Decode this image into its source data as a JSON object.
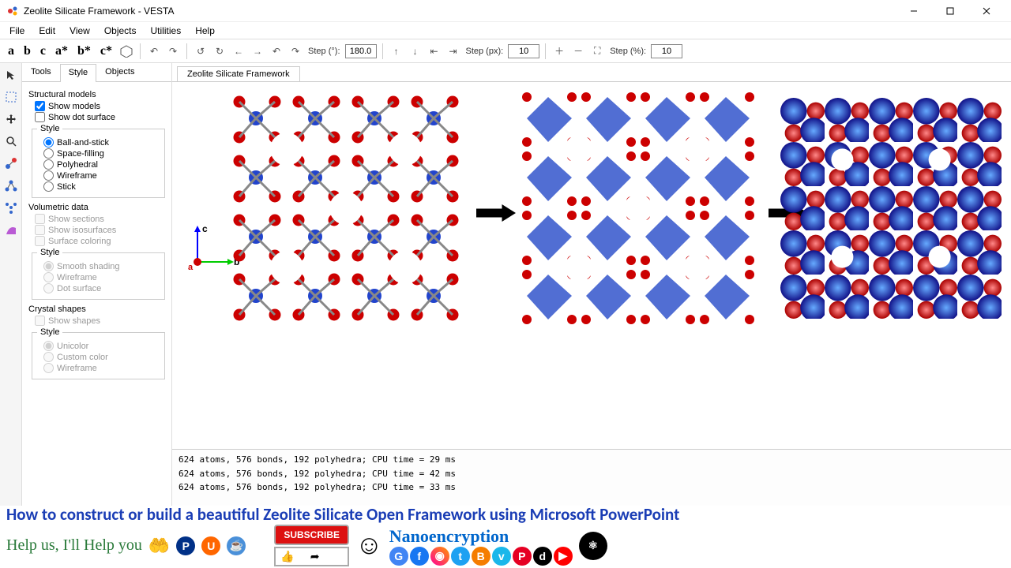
{
  "window": {
    "title": "Zeolite Silicate Framework - VESTA"
  },
  "menu": {
    "items": [
      "File",
      "Edit",
      "View",
      "Objects",
      "Utilities",
      "Help"
    ]
  },
  "toolbar": {
    "axis_buttons": [
      "a",
      "b",
      "c",
      "a*",
      "b*",
      "c*"
    ],
    "step_deg_label": "Step (°):",
    "step_deg": "180.0",
    "step_px_label": "Step (px):",
    "step_px": "10",
    "step_pct_label": "Step (%):",
    "step_pct": "10"
  },
  "side": {
    "tabs": [
      "Tools",
      "Style",
      "Objects"
    ],
    "active_tab": 1,
    "structural_title": "Structural models",
    "show_models": "Show models",
    "show_dot": "Show dot surface",
    "style_legend": "Style",
    "styles": [
      "Ball-and-stick",
      "Space-filling",
      "Polyhedral",
      "Wireframe",
      "Stick"
    ],
    "style_selected": 0,
    "vol_title": "Volumetric data",
    "vol_checks": [
      "Show sections",
      "Show isosurfaces",
      "Surface coloring"
    ],
    "vol_styles": [
      "Smooth shading",
      "Wireframe",
      "Dot surface"
    ],
    "crystal_title": "Crystal shapes",
    "show_shapes": "Show shapes",
    "crystal_styles": [
      "Unicolor",
      "Custom color",
      "Wireframe"
    ]
  },
  "doc": {
    "tab": "Zeolite Silicate Framework"
  },
  "axes": {
    "c": "c",
    "b": "b",
    "a": "a"
  },
  "console": {
    "lines": [
      "624 atoms, 576 bonds, 192 polyhedra; CPU time = 29 ms",
      "624 atoms, 576 bonds, 192 polyhedra; CPU time = 42 ms",
      "624 atoms, 576 bonds, 192 polyhedra; CPU time = 33 ms"
    ]
  },
  "footer": {
    "headline": "How to construct or build a beautiful Zeolite Silicate Open Framework using Microsoft PowerPoint",
    "help": "Help us, I'll Help you",
    "subscribe": "SUBSCRIBE",
    "brand": "Nanoencryption"
  }
}
